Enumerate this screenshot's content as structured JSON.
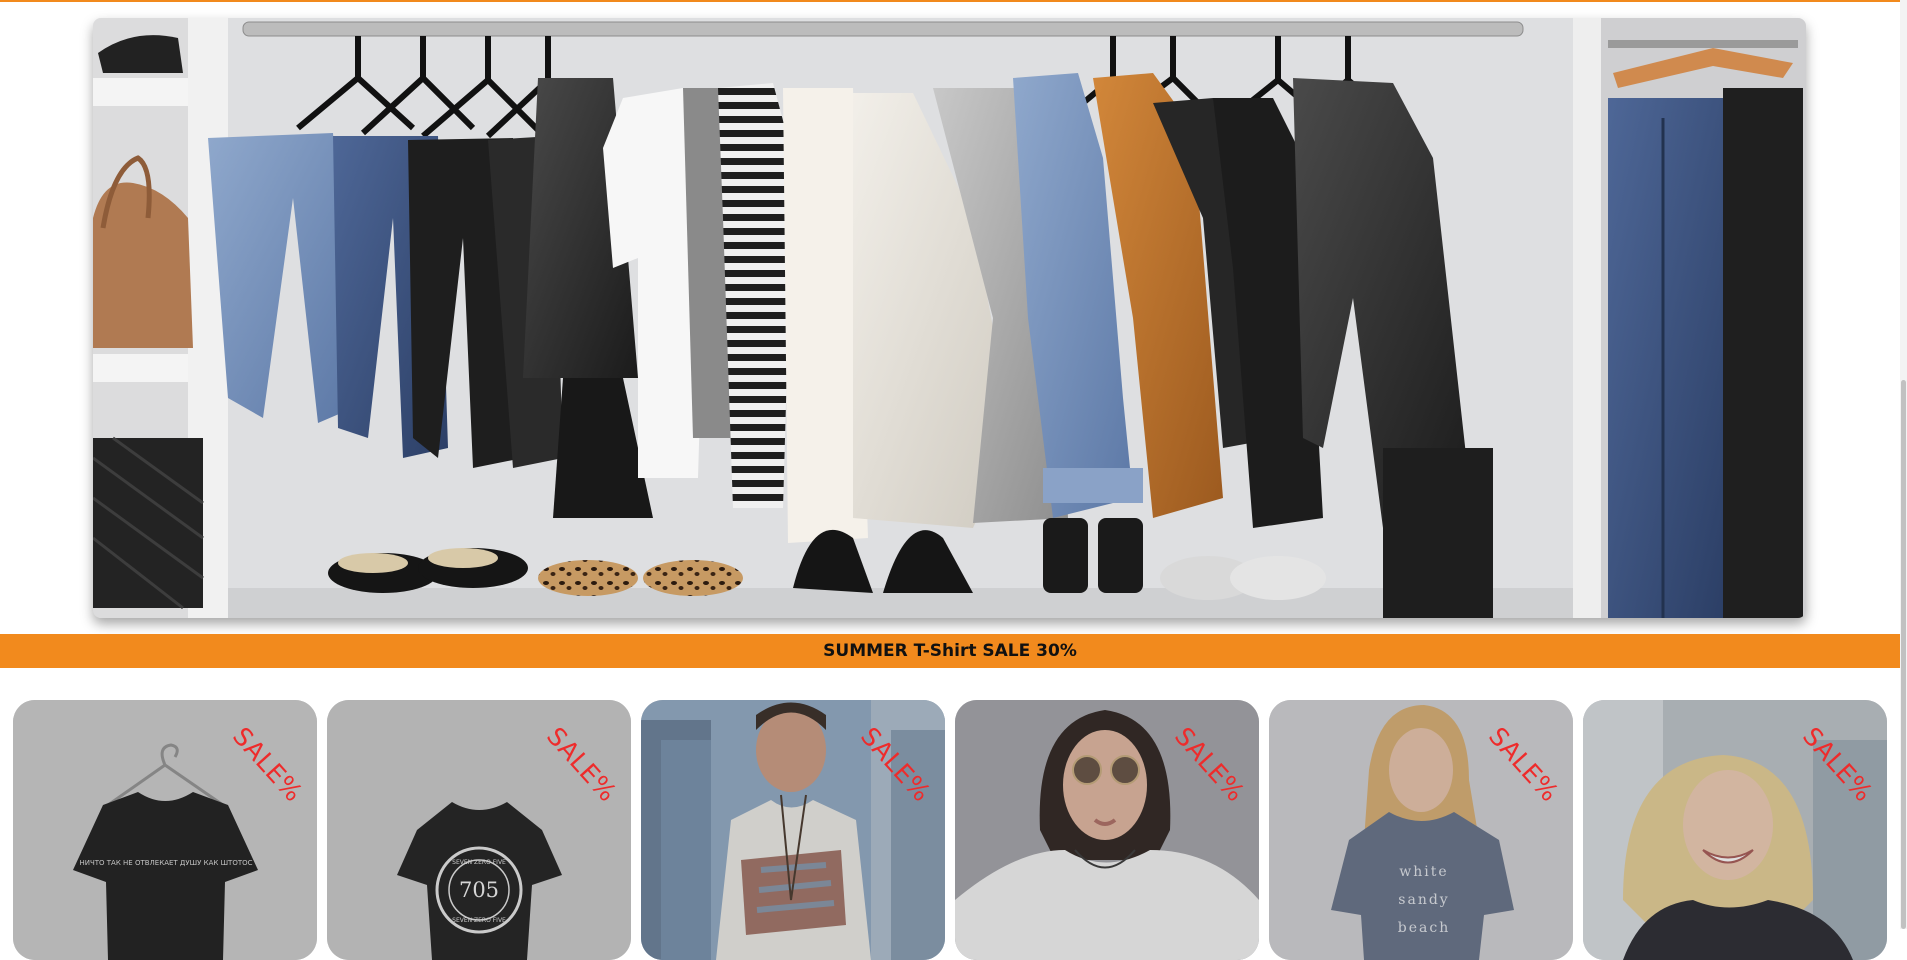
{
  "colors": {
    "accent_orange": "#f28a1d",
    "sale_red": "#ee2b2b",
    "banner_text": "#111111",
    "card_gray": "#b9b9b9"
  },
  "hero": {
    "image": "wardrobe-clothing-rack-photo"
  },
  "sale_banner": {
    "text": "SUMMER T-Shirt SALE 30%"
  },
  "products": [
    {
      "image": "black-tshirt-on-hanger",
      "sale_label": "SALE%",
      "shirt_print": "НИЧТО ТАК НЕ ОТВЛЕКАЕТ ДУШУ КАК ШТОТОС"
    },
    {
      "image": "black-tshirt-705-print",
      "sale_label": "SALE%",
      "shirt_print_top": "SEVEN ZERO FIVE",
      "shirt_print_number": "705",
      "shirt_print_bottom": "SEVEN ZERO FIVE"
    },
    {
      "image": "man-flag-tshirt",
      "sale_label": "SALE%"
    },
    {
      "image": "woman-white-tshirt-sunglasses",
      "sale_label": "SALE%"
    },
    {
      "image": "woman-gray-tshirt",
      "sale_label": "SALE%",
      "shirt_print": [
        "white",
        "sandy",
        "beach"
      ]
    },
    {
      "image": "smiling-woman-black-tshirt",
      "sale_label": "SALE%"
    }
  ]
}
